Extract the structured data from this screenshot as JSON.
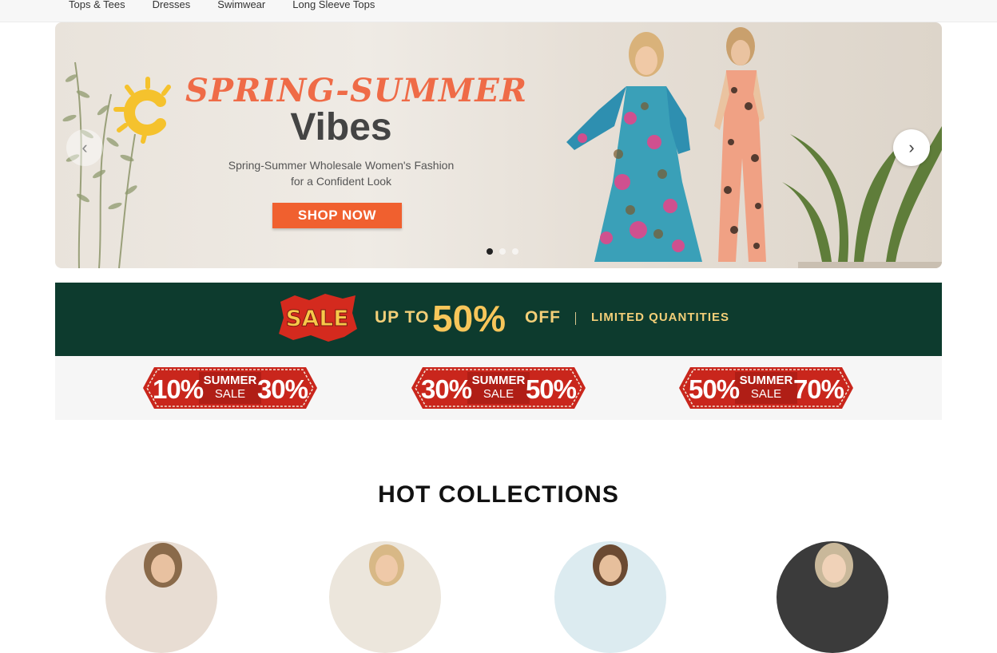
{
  "nav": {
    "items": [
      {
        "label": "Tops & Tees"
      },
      {
        "label": "Dresses"
      },
      {
        "label": "Swimwear"
      },
      {
        "label": "Long Sleeve Tops"
      }
    ]
  },
  "hero": {
    "title": "SPRING-SUMMER",
    "headline": "Vibes",
    "subtitle_line1": "Spring-Summer Wholesale Women's Fashion",
    "subtitle_line2": "for a Confident Look",
    "cta_label": "SHOP NOW",
    "prev_icon": "chevron-left-icon",
    "next_icon": "chevron-right-icon",
    "slide_count": 3,
    "active_slide": 1
  },
  "sale_banner": {
    "sticker": "SALE",
    "up_to": "UP TO",
    "percent": "50%",
    "off": "OFF",
    "limited": "LIMITED QUANTITIES"
  },
  "sale_tags": [
    {
      "from": "10%",
      "label1": "SUMMER",
      "label2": "SALE",
      "to": "30%"
    },
    {
      "from": "30%",
      "label1": "SUMMER",
      "label2": "SALE",
      "to": "50%"
    },
    {
      "from": "50%",
      "label1": "SUMMER",
      "label2": "SALE",
      "to": "70%"
    }
  ],
  "hot_collections": {
    "title": "HOT COLLECTIONS"
  },
  "colors": {
    "accent_orange": "#f0602f",
    "banner_green": "#0d3b2e",
    "banner_gold": "#f7c65a",
    "tag_red": "#c9261c"
  }
}
